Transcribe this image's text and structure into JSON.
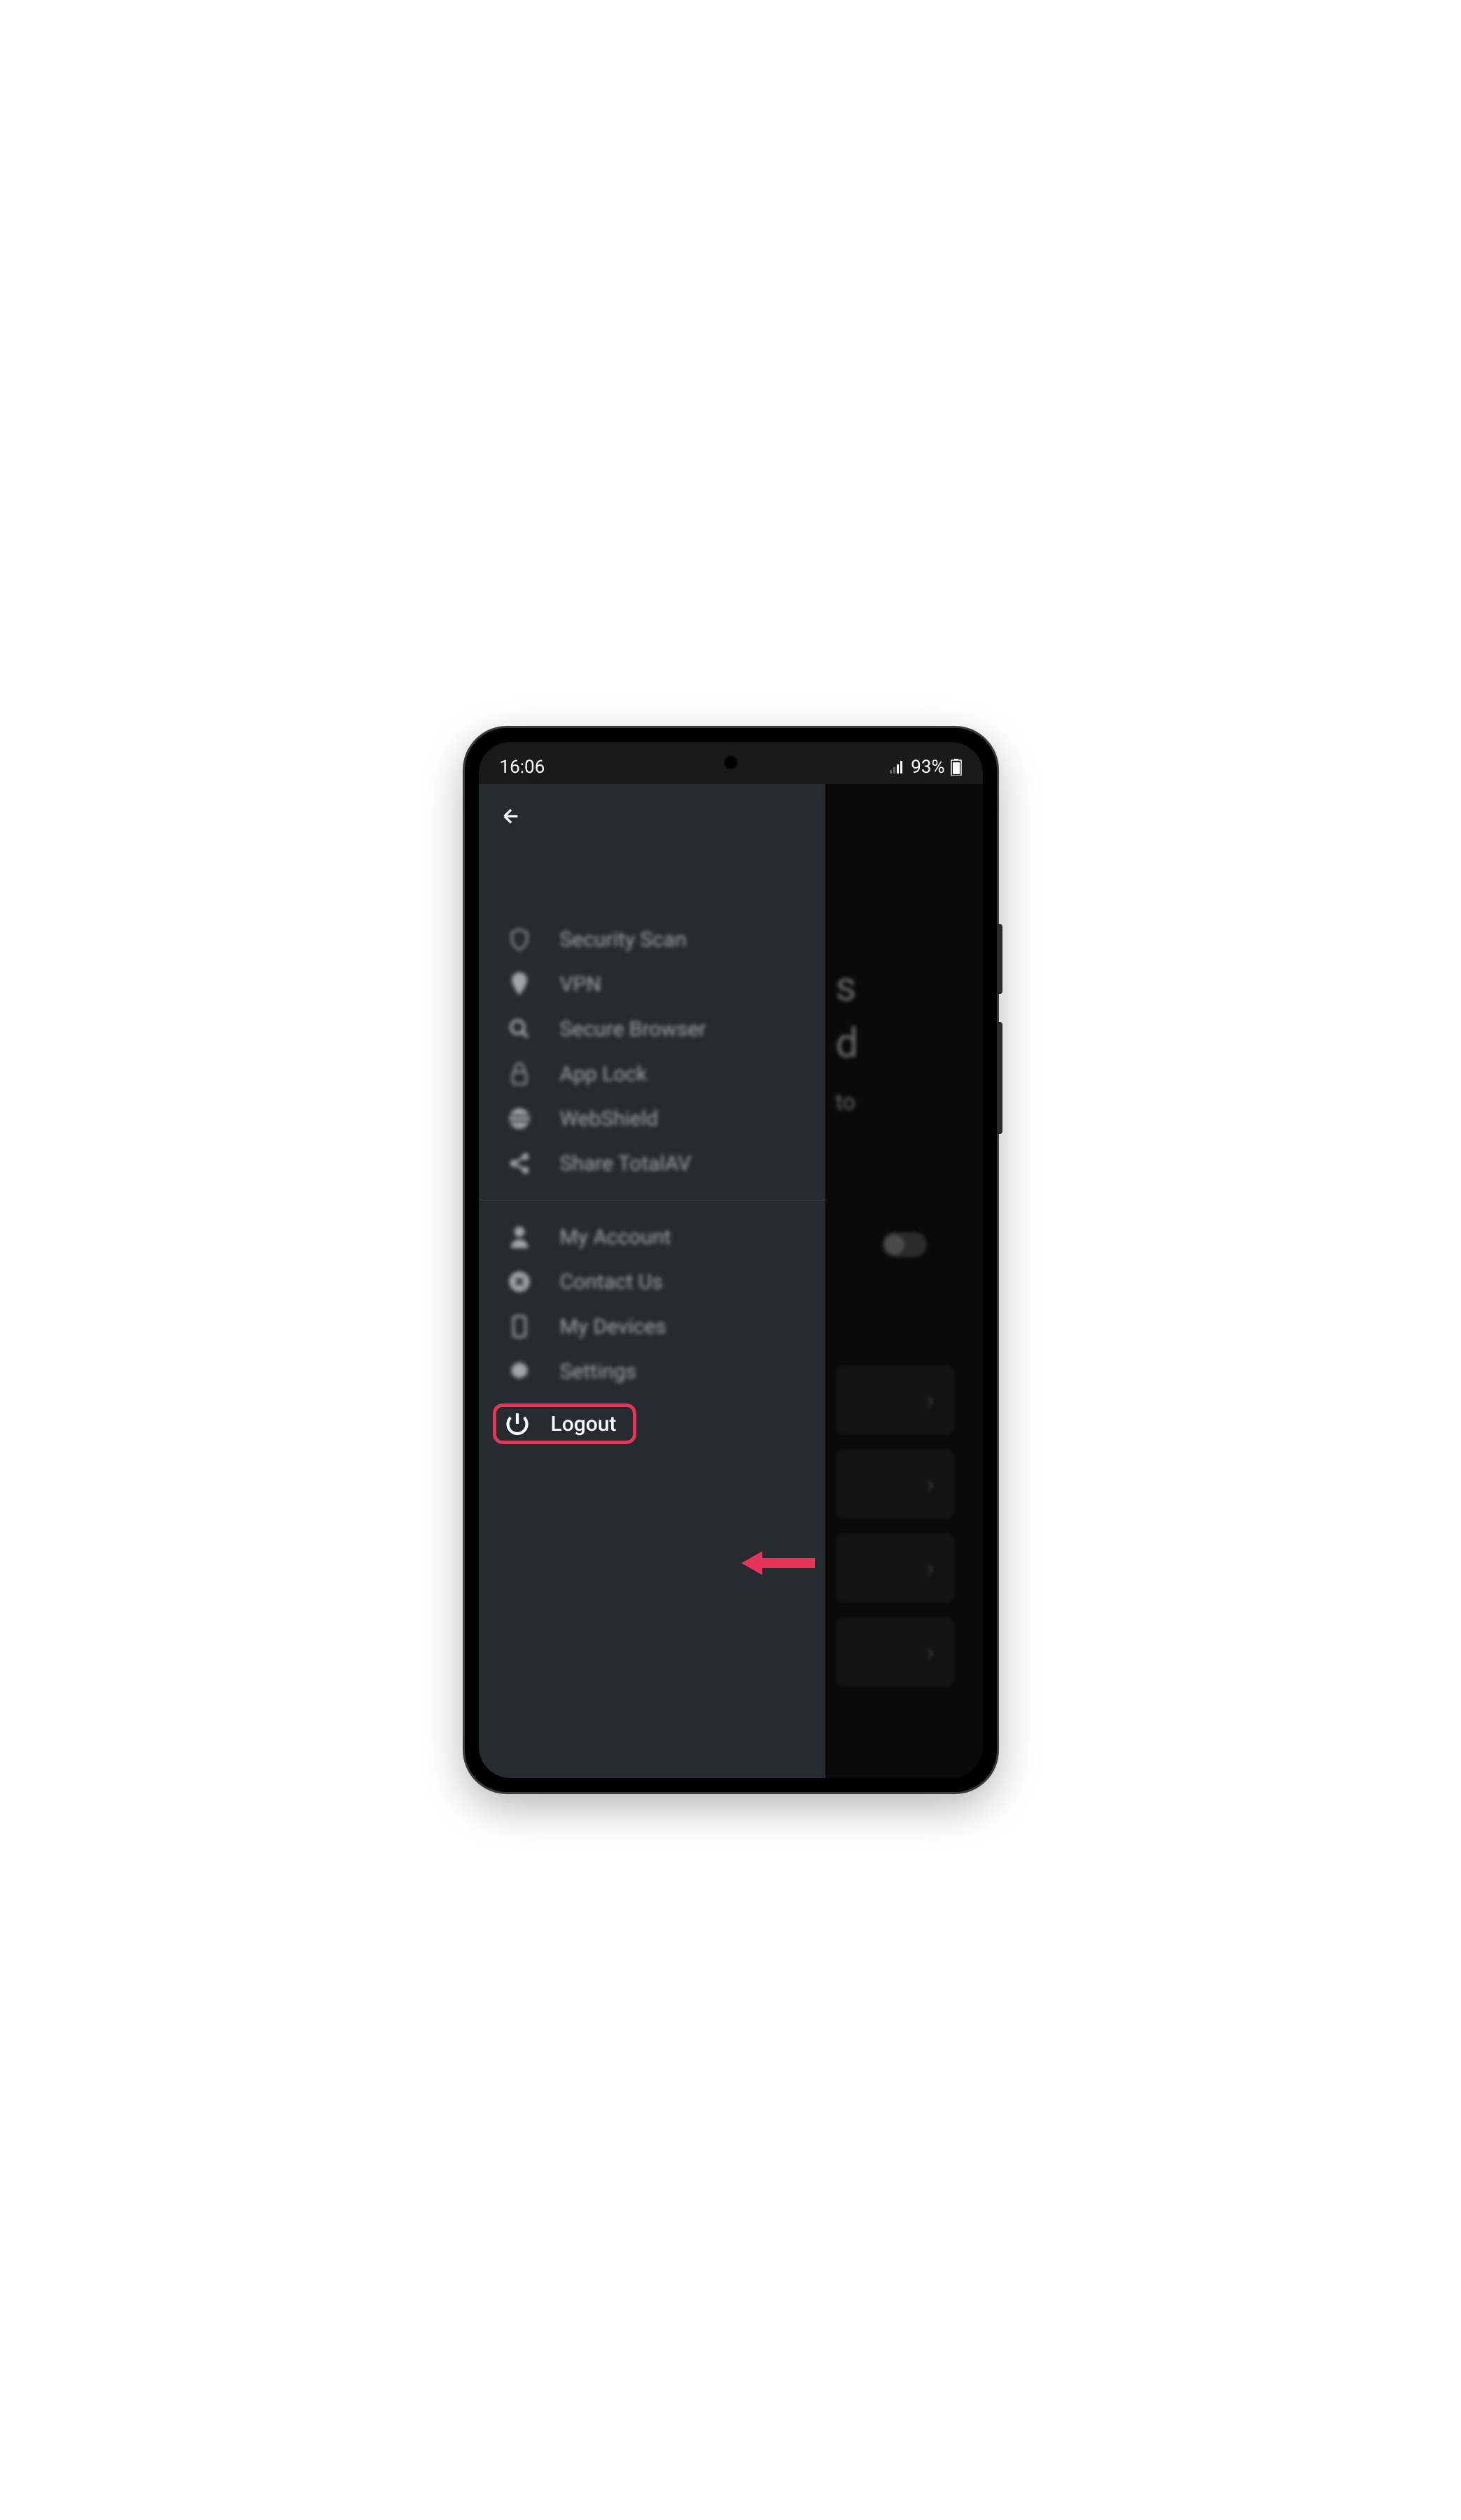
{
  "status": {
    "time": "16:06",
    "battery_pct": "93%"
  },
  "drawer": {
    "group1": [
      {
        "icon": "shield",
        "label": "Security Scan"
      },
      {
        "icon": "vpn-pin",
        "label": "VPN"
      },
      {
        "icon": "search",
        "label": "Secure Browser"
      },
      {
        "icon": "lock",
        "label": "App Lock"
      },
      {
        "icon": "globe",
        "label": "WebShield"
      },
      {
        "icon": "share",
        "label": "Share TotalAV"
      }
    ],
    "group2": [
      {
        "icon": "user",
        "label": "My Account"
      },
      {
        "icon": "circle-x",
        "label": "Contact Us"
      },
      {
        "icon": "phone",
        "label": "My Devices"
      },
      {
        "icon": "gear",
        "label": "Settings"
      }
    ],
    "logout_label": "Logout"
  },
  "annotation": {
    "highlight_color": "#e6355a"
  }
}
